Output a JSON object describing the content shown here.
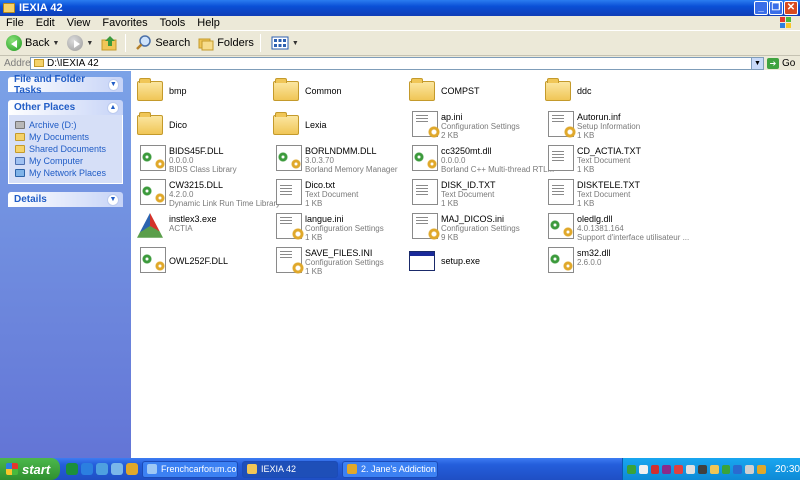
{
  "window": {
    "title": "IEXIA 42"
  },
  "menu": [
    "File",
    "Edit",
    "View",
    "Favorites",
    "Tools",
    "Help"
  ],
  "toolbar": {
    "back": "Back",
    "search": "Search",
    "folders": "Folders"
  },
  "address": {
    "label": "Address",
    "value": "D:\\IEXIA 42",
    "go": "Go"
  },
  "left_pane": {
    "file_tasks": "File and Folder Tasks",
    "other_places": {
      "title": "Other Places",
      "items": [
        "Archive (D:)",
        "My Documents",
        "Shared Documents",
        "My Computer",
        "My Network Places"
      ]
    },
    "details": "Details"
  },
  "files": [
    {
      "name": "bmp",
      "l1": "",
      "l2": "",
      "icon": "folder-icon"
    },
    {
      "name": "Common",
      "l1": "",
      "l2": "",
      "icon": "folder-icon"
    },
    {
      "name": "COMPST",
      "l1": "",
      "l2": "",
      "icon": "folder-icon"
    },
    {
      "name": "ddc",
      "l1": "",
      "l2": "",
      "icon": "folder-icon"
    },
    {
      "name": "Dico",
      "l1": "",
      "l2": "",
      "icon": "folder-icon"
    },
    {
      "name": "Lexia",
      "l1": "",
      "l2": "",
      "icon": "folder-icon"
    },
    {
      "name": "ap.ini",
      "l1": "Configuration Settings",
      "l2": "2 KB",
      "icon": "config-file-icon"
    },
    {
      "name": "Autorun.inf",
      "l1": "Setup Information",
      "l2": "1 KB",
      "icon": "config-file-icon"
    },
    {
      "name": "BIDS45F.DLL",
      "l1": "0.0.0.0",
      "l2": "BIDS Class Library",
      "icon": "dll-icon"
    },
    {
      "name": "BORLNDMM.DLL",
      "l1": "3.0.3.70",
      "l2": "Borland Memory Manager",
      "icon": "dll-icon"
    },
    {
      "name": "cc3250mt.dll",
      "l1": "0.0.0.0",
      "l2": "Borland C++ Multi-thread RTL...",
      "icon": "dll-icon"
    },
    {
      "name": "CD_ACTIA.TXT",
      "l1": "Text Document",
      "l2": "1 KB",
      "icon": "text-file-icon"
    },
    {
      "name": "CW3215.DLL",
      "l1": "4.2.0.0",
      "l2": "Dynamic Link Run Time Library",
      "icon": "dll-icon"
    },
    {
      "name": "Dico.txt",
      "l1": "Text Document",
      "l2": "1 KB",
      "icon": "text-file-icon"
    },
    {
      "name": "DISK_ID.TXT",
      "l1": "Text Document",
      "l2": "1 KB",
      "icon": "text-file-icon"
    },
    {
      "name": "DISKTELE.TXT",
      "l1": "Text Document",
      "l2": "1 KB",
      "icon": "text-file-icon"
    },
    {
      "name": "instlex3.exe",
      "l1": "ACTIA",
      "l2": "",
      "icon": "installer-icon"
    },
    {
      "name": "langue.ini",
      "l1": "Configuration Settings",
      "l2": "1 KB",
      "icon": "config-file-icon"
    },
    {
      "name": "MAJ_DICOS.ini",
      "l1": "Configuration Settings",
      "l2": "9 KB",
      "icon": "config-file-icon"
    },
    {
      "name": "oledlg.dll",
      "l1": "4.0.1381.164",
      "l2": "Support d'interface utilisateur ...",
      "icon": "dll-icon"
    },
    {
      "name": "OWL252F.DLL",
      "l1": "",
      "l2": "",
      "icon": "dll-icon"
    },
    {
      "name": "SAVE_FILES.INI",
      "l1": "Configuration Settings",
      "l2": "1 KB",
      "icon": "config-file-icon"
    },
    {
      "name": "setup.exe",
      "l1": "",
      "l2": "",
      "icon": "application-icon"
    },
    {
      "name": "sm32.dll",
      "l1": "2.6.0.0",
      "l2": "",
      "icon": "dll-icon"
    }
  ],
  "taskbar": {
    "start": "start",
    "tasks": [
      "Frenchcarforum.co.u...",
      "IEXIA 42",
      "2. Jane's Addiction - ..."
    ],
    "clock": "20:30"
  }
}
